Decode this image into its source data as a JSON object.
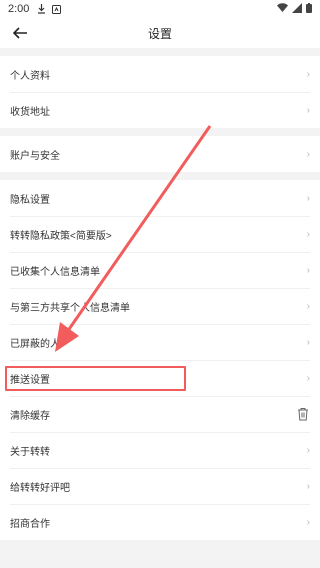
{
  "status": {
    "time": "2:00"
  },
  "header": {
    "title": "设置"
  },
  "groups": [
    {
      "items": [
        "个人资料",
        "收货地址"
      ]
    },
    {
      "items": [
        "账户与安全"
      ]
    },
    {
      "items": [
        "隐私设置",
        "转转隐私政策<简要版>",
        "已收集个人信息清单",
        "与第三方共享个人信息清单",
        "已屏蔽的人",
        "推送设置",
        "清除缓存",
        "关于转转",
        "给转转好评吧",
        "招商合作"
      ]
    }
  ],
  "highlight_target": "推送设置",
  "colors": {
    "highlight": "#f25c5c",
    "background": "#f3f3f3",
    "row_bg": "#ffffff"
  },
  "icons": {
    "back": "arrow-left-icon",
    "chevron": "chevron-right-icon",
    "trash": "trash-icon"
  }
}
